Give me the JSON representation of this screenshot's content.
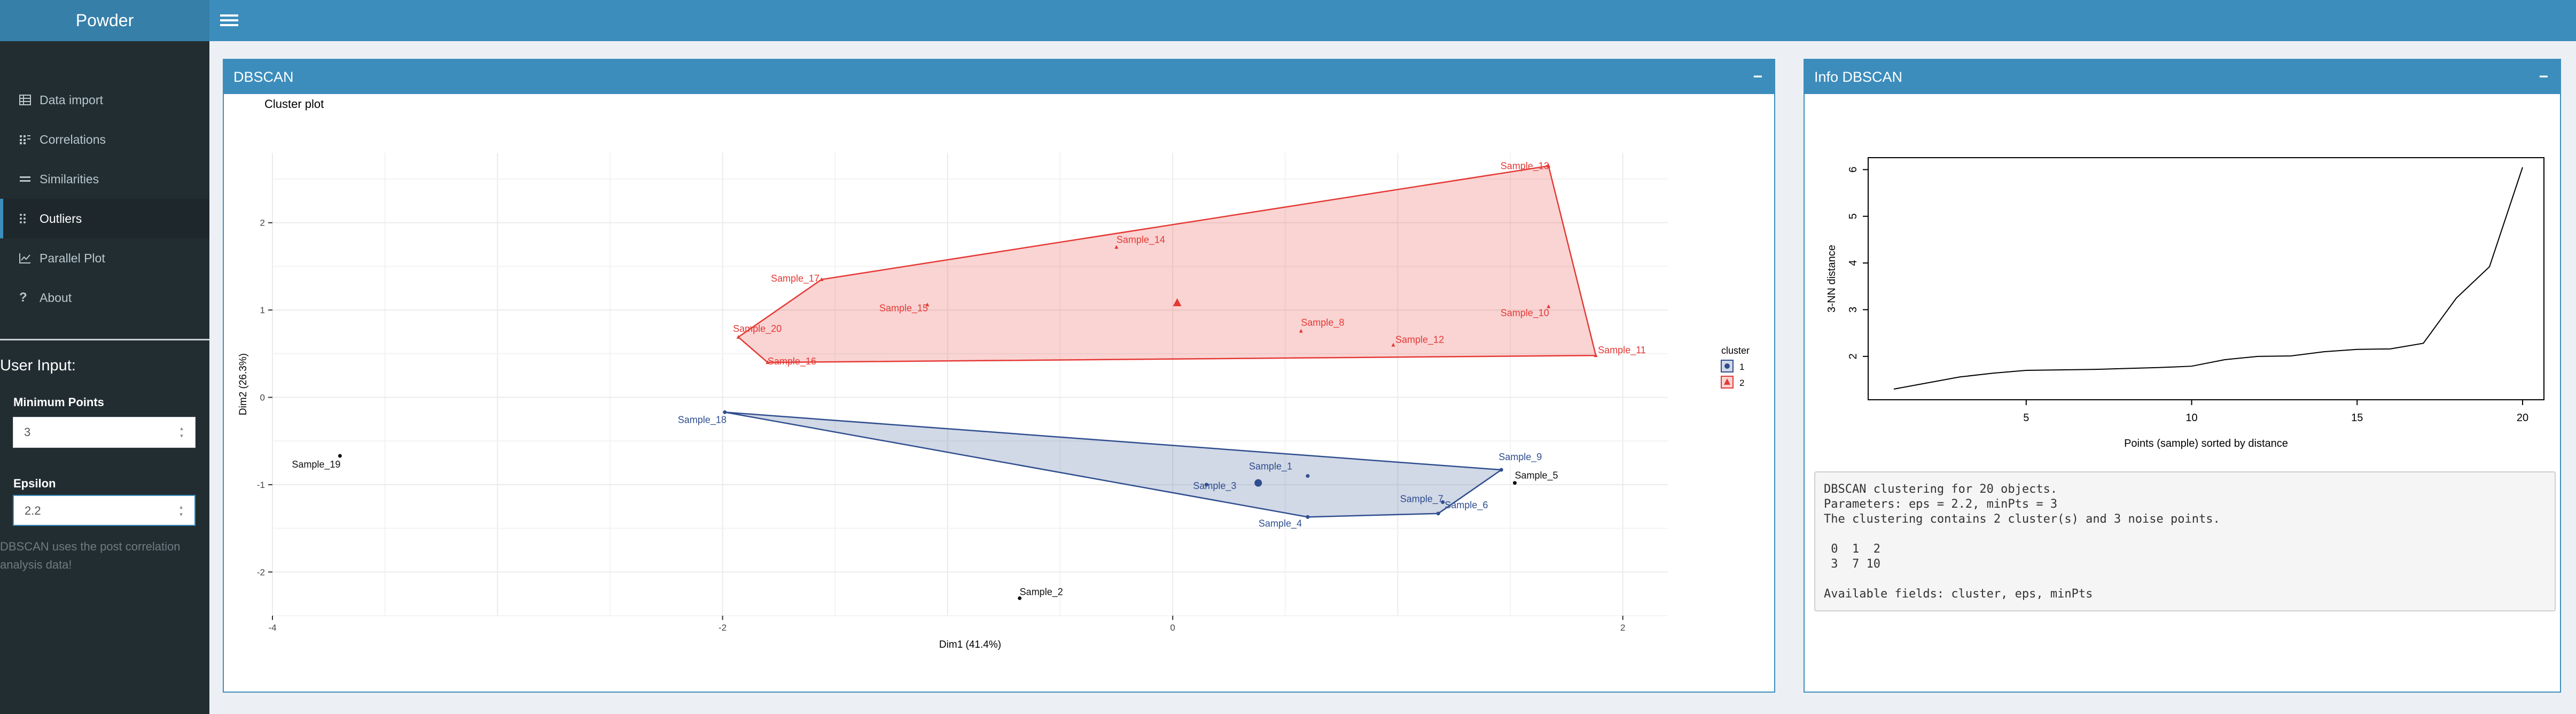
{
  "app": {
    "title": "Powder"
  },
  "sidebar": {
    "items": [
      {
        "label": "Data import",
        "icon": "table-icon"
      },
      {
        "label": "Correlations",
        "icon": "th-icon"
      },
      {
        "label": "Similarities",
        "icon": "equals-icon"
      },
      {
        "label": "Outliers",
        "icon": "braille-icon"
      },
      {
        "label": "Parallel Plot",
        "icon": "line-chart-icon"
      },
      {
        "label": "About",
        "icon": "question-icon"
      }
    ],
    "active_item": "Outliers",
    "user_input_title": "User Input:",
    "min_points_label": "Minimum Points",
    "min_points_value": "3",
    "epsilon_label": "Epsilon",
    "epsilon_value": "2.2",
    "note": "DBSCAN uses the post correlation analysis data!"
  },
  "dbscan_box": {
    "title": "DBSCAN",
    "collapse_label": "−",
    "plot_title": "Cluster plot",
    "xlabel": "Dim1 (41.4%)",
    "ylabel": "Dim2 (26.3%)",
    "legend_title": "cluster",
    "colors": {
      "cluster1": "#2f4e8f",
      "cluster2": "#e53935",
      "noise": "#111111"
    }
  },
  "info_box": {
    "title": "Info DBSCAN",
    "collapse_label": "−",
    "knn_ylabel": "3-NN distance",
    "knn_xlabel": "Points (sample) sorted by distance",
    "info_text": "DBSCAN clustering for 20 objects.\nParameters: eps = 2.2, minPts = 3\nThe clustering contains 2 cluster(s) and 3 noise points.\n\n 0  1  2\n 3  7 10\n\nAvailable fields: cluster, eps, minPts"
  },
  "chart_data": [
    {
      "type": "scatter",
      "title": "Cluster plot",
      "xlabel": "Dim1 (41.4%)",
      "ylabel": "Dim2 (26.3%)",
      "xlim": [
        -4,
        2.2
      ],
      "ylim": [
        -2.5,
        2.8
      ],
      "xticks": [
        -4,
        -2,
        0,
        2
      ],
      "yticks": [
        -2,
        -1,
        0,
        1,
        2
      ],
      "grid": true,
      "legend": {
        "title": "cluster",
        "entries": [
          "1",
          "2"
        ],
        "position": "right"
      },
      "points": [
        {
          "label": "Sample_1",
          "x": 0.6,
          "y": -0.9,
          "cluster": 1
        },
        {
          "label": "Sample_2",
          "x": -0.68,
          "y": -2.3,
          "cluster": 0
        },
        {
          "label": "Sample_3",
          "x": 0.15,
          "y": -1.0,
          "cluster": 1
        },
        {
          "label": "Sample_4",
          "x": 0.6,
          "y": -1.37,
          "cluster": 1
        },
        {
          "label": "Sample_5",
          "x": 1.52,
          "y": -0.98,
          "cluster": 0
        },
        {
          "label": "Sample_6",
          "x": 1.18,
          "y": -1.33,
          "cluster": 1
        },
        {
          "label": "Sample_7",
          "x": 1.2,
          "y": -1.2,
          "cluster": 1
        },
        {
          "label": "Sample_8",
          "x": 0.57,
          "y": 0.76,
          "cluster": 2
        },
        {
          "label": "Sample_9",
          "x": 1.46,
          "y": -0.83,
          "cluster": 1
        },
        {
          "label": "Sample_10",
          "x": 1.67,
          "y": 1.04,
          "cluster": 2
        },
        {
          "label": "Sample_11",
          "x": 1.88,
          "y": 0.48,
          "cluster": 2
        },
        {
          "label": "Sample_12",
          "x": 0.98,
          "y": 0.6,
          "cluster": 2
        },
        {
          "label": "Sample_13",
          "x": 1.67,
          "y": 2.65,
          "cluster": 2
        },
        {
          "label": "Sample_14",
          "x": -0.25,
          "y": 1.72,
          "cluster": 2
        },
        {
          "label": "Sample_15",
          "x": -1.09,
          "y": 1.06,
          "cluster": 2
        },
        {
          "label": "Sample_16",
          "x": -1.8,
          "y": 0.4,
          "cluster": 2
        },
        {
          "label": "Sample_17",
          "x": -1.56,
          "y": 1.35,
          "cluster": 2
        },
        {
          "label": "Sample_18",
          "x": -1.99,
          "y": -0.17,
          "cluster": 1
        },
        {
          "label": "Sample_19",
          "x": -3.7,
          "y": -0.67,
          "cluster": 0
        },
        {
          "label": "Sample_20",
          "x": -1.93,
          "y": 0.69,
          "cluster": 2
        }
      ],
      "centroids": [
        {
          "cluster": 1,
          "x": 0.38,
          "y": -0.98
        },
        {
          "cluster": 2,
          "x": 0.02,
          "y": 1.08
        }
      ],
      "hull_1": [
        "Sample_18",
        "Sample_9",
        "Sample_6",
        "Sample_4"
      ],
      "hull_2": [
        "Sample_20",
        "Sample_17",
        "Sample_13",
        "Sample_11",
        "Sample_16"
      ]
    },
    {
      "type": "line",
      "xlabel": "Points (sample) sorted by distance",
      "ylabel": "3-NN distance",
      "xlim": [
        0,
        21
      ],
      "ylim": [
        1,
        6.2
      ],
      "xticks": [
        5,
        10,
        15,
        20
      ],
      "yticks": [
        2,
        3,
        4,
        5,
        6
      ],
      "x": [
        1,
        2,
        3,
        4,
        5,
        6,
        7,
        8,
        9,
        10,
        11,
        12,
        13,
        14,
        15,
        16,
        17,
        18,
        19,
        20
      ],
      "y": [
        1.3,
        1.43,
        1.56,
        1.64,
        1.7,
        1.71,
        1.72,
        1.74,
        1.76,
        1.79,
        1.93,
        2.0,
        2.01,
        2.1,
        2.15,
        2.16,
        2.28,
        3.25,
        3.92,
        6.05
      ]
    }
  ]
}
